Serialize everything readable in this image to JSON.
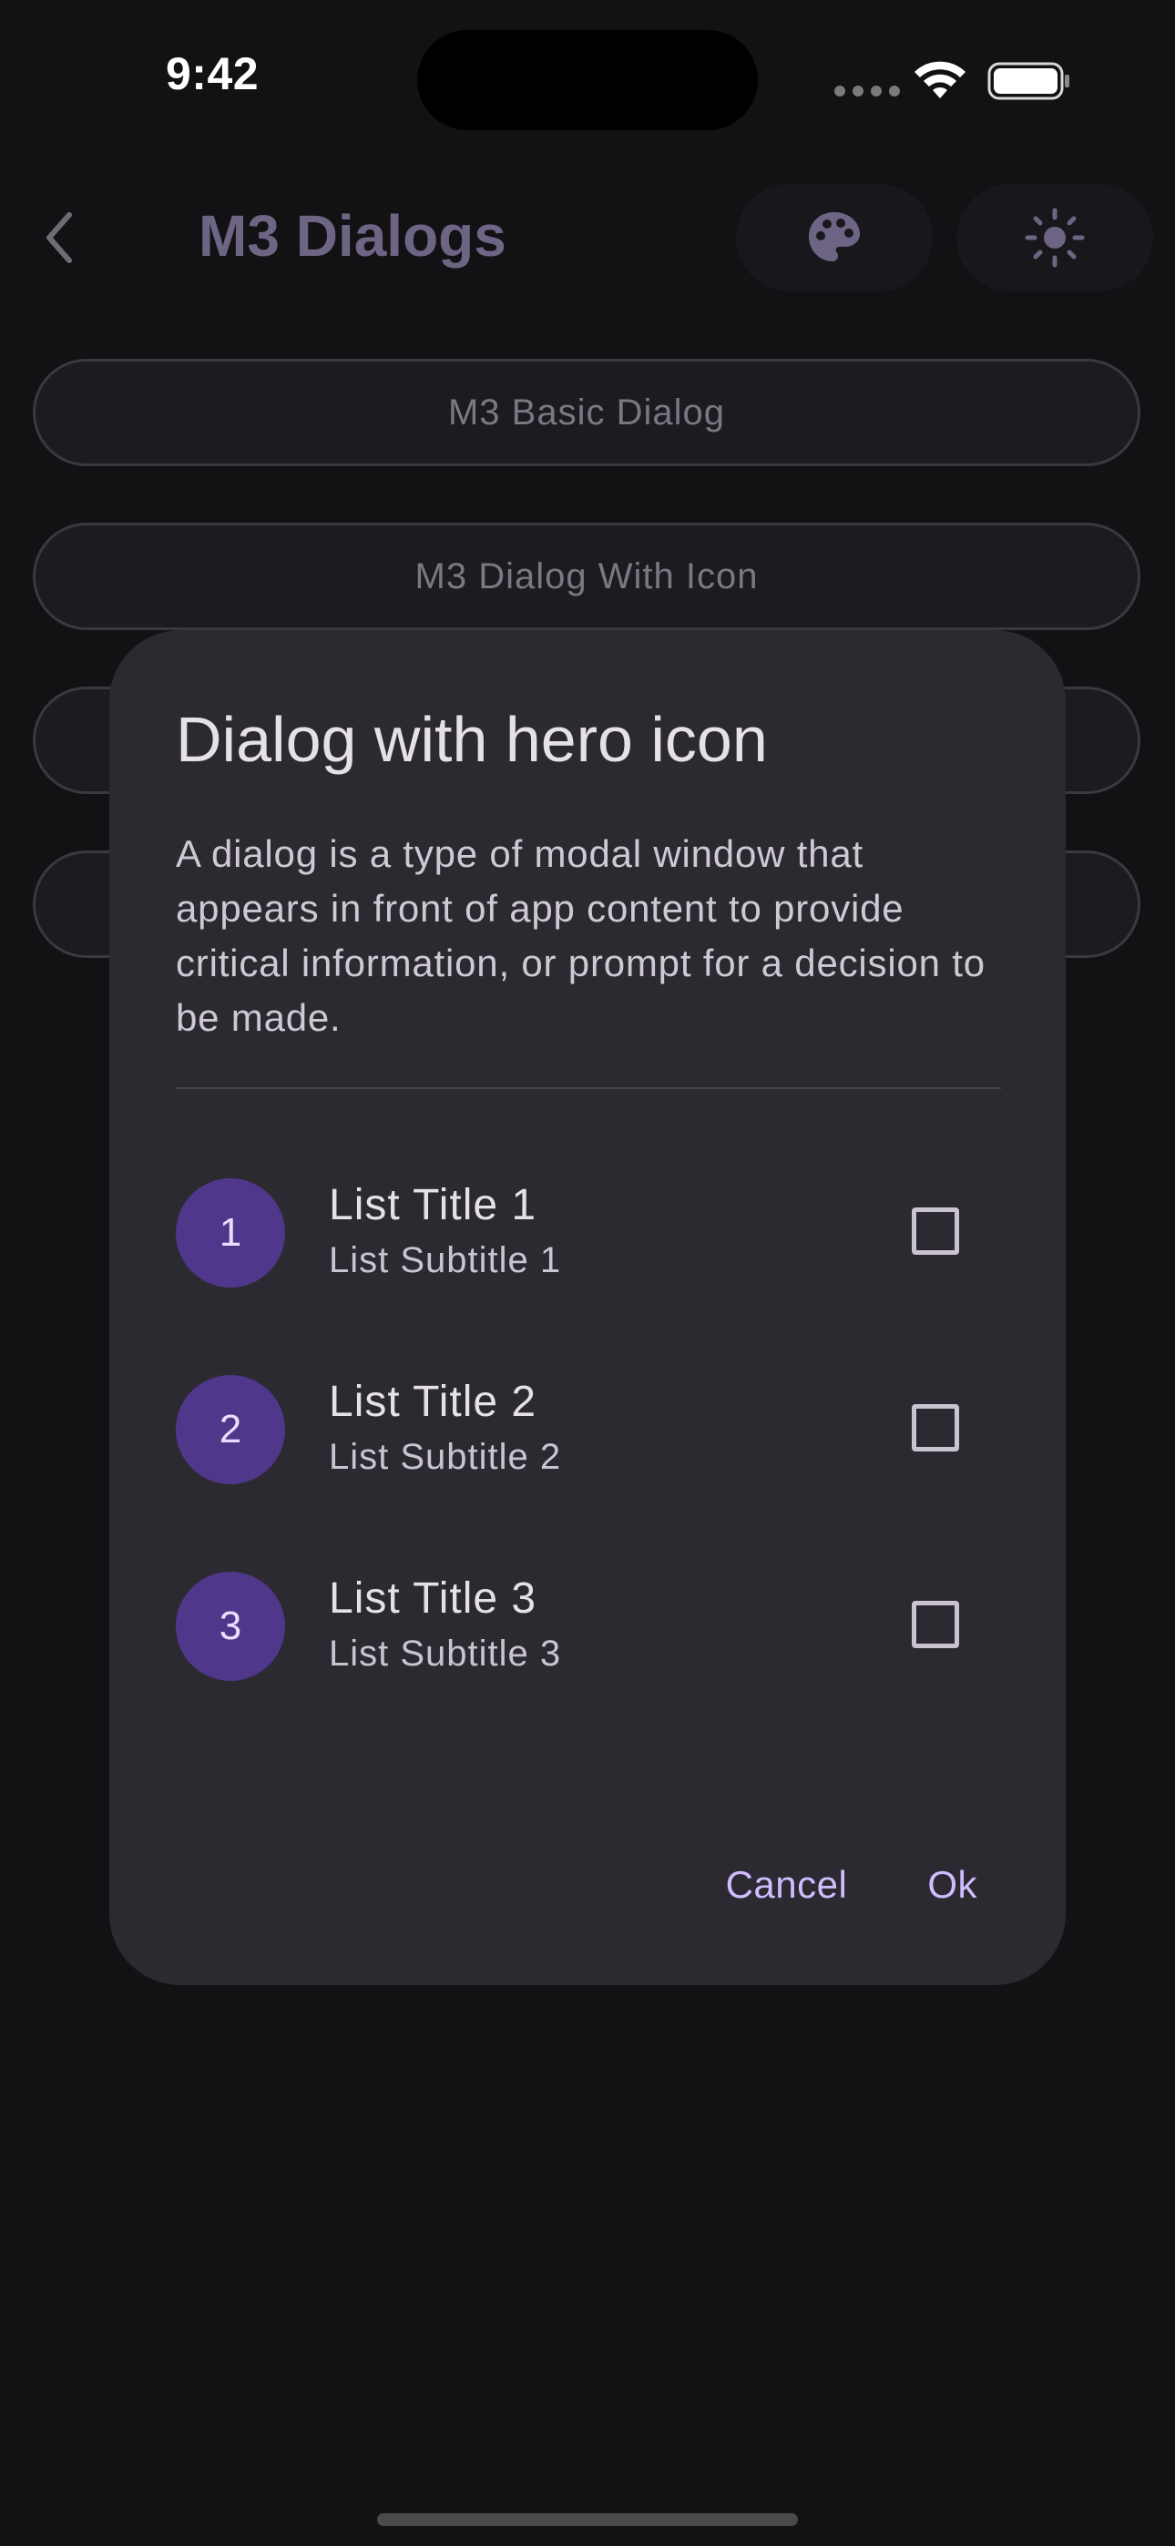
{
  "status_bar": {
    "time": "9:42"
  },
  "app_bar": {
    "title": "M3 Dialogs",
    "back_icon": "chevron-left-icon",
    "palette_icon": "palette-icon",
    "theme_icon": "sun-icon"
  },
  "background_buttons": [
    {
      "label": "M3 Basic Dialog"
    },
    {
      "label": "M3 Dialog With Icon"
    },
    {
      "label": ""
    },
    {
      "label": ""
    }
  ],
  "dialog": {
    "title": "Dialog with hero icon",
    "body": "A dialog is a type of modal window that appears in front of app content to provide critical information, or prompt for a decision to be made.",
    "items": [
      {
        "avatar": "1",
        "title": "List Title 1",
        "subtitle": "List Subtitle 1",
        "checked": false
      },
      {
        "avatar": "2",
        "title": "List Title 2",
        "subtitle": "List Subtitle 2",
        "checked": false
      },
      {
        "avatar": "3",
        "title": "List Title 3",
        "subtitle": "List Subtitle 3",
        "checked": false
      }
    ],
    "cancel_label": "Cancel",
    "ok_label": "Ok"
  },
  "colors": {
    "primary": "#d0bcff",
    "avatar_bg": "#4f378b",
    "dialog_surface": "#2c2a31",
    "background": "#121114"
  }
}
